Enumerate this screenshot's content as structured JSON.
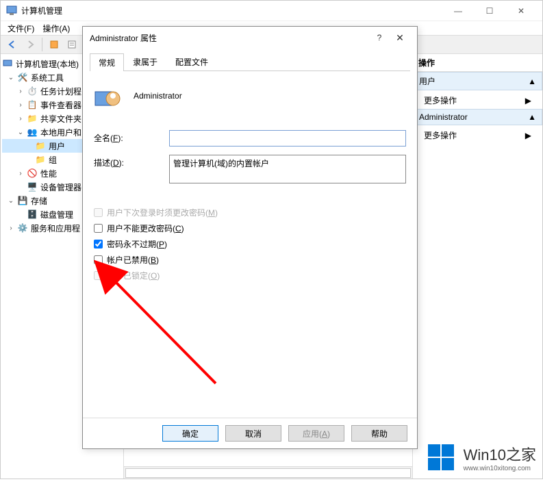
{
  "window": {
    "title": "计算机管理",
    "menu": {
      "file": "文件(F)",
      "action": "操作(A)"
    },
    "controls": {
      "min": "—",
      "max": "☐",
      "close": "✕"
    }
  },
  "tree": {
    "root": "计算机管理(本地)",
    "sys_tools": "系统工具",
    "task_scheduler": "任务计划程",
    "event_viewer": "事件查看器",
    "shared_folders": "共享文件夹",
    "local_users": "本地用户和",
    "users": "用户",
    "groups": "组",
    "performance": "性能",
    "device_mgr": "设备管理器",
    "storage": "存储",
    "disk_mgmt": "磁盘管理",
    "services": "服务和应用程"
  },
  "actions": {
    "header": "操作",
    "group1": "用户",
    "more1": "更多操作",
    "group2": "Administrator",
    "more2": "更多操作"
  },
  "dialog": {
    "title": "Administrator 属性",
    "tabs": {
      "general": "常规",
      "member_of": "隶属于",
      "profile": "配置文件"
    },
    "username": "Administrator",
    "fullname_label": "全名(F):",
    "fullname_value": "",
    "desc_label": "描述(D):",
    "desc_value": "管理计算机(域)的内置帐户",
    "cb_change_pwd": "用户下次登录时须更改密码(M)",
    "cb_cannot_change": "用户不能更改密码(C)",
    "cb_never_expire": "密码永不过期(P)",
    "cb_disabled": "帐户已禁用(B)",
    "cb_locked": "帐户已锁定(O)",
    "buttons": {
      "ok": "确定",
      "cancel": "取消",
      "apply": "应用(A)",
      "help": "帮助"
    }
  },
  "watermark": {
    "title": "Win10之家",
    "url": "www.win10xitong.com"
  }
}
